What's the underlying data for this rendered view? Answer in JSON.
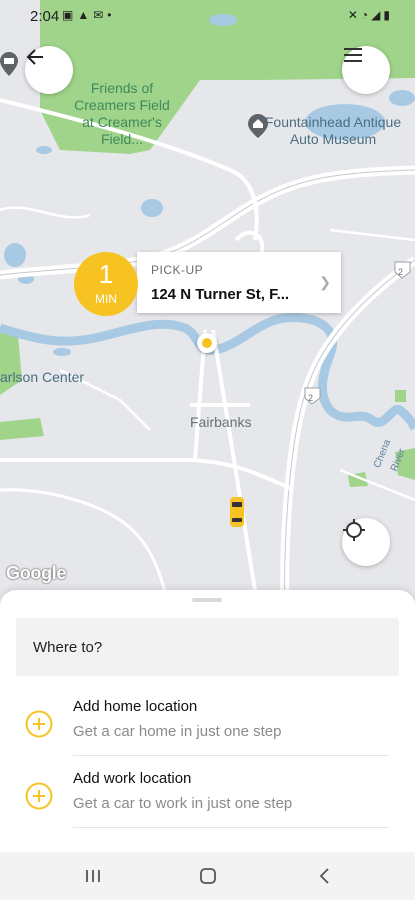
{
  "status_bar": {
    "time": "2:04",
    "left_icons": [
      "image-icon",
      "alert-icon",
      "mail-icon",
      "dot-icon"
    ],
    "right_icons": [
      "mute-icon",
      "wifi-icon",
      "signal-icon",
      "battery-icon"
    ]
  },
  "map": {
    "labels": {
      "friends_field": "Friends of\nCreamers Field\nat Creamer's\nField...",
      "museum": "Fountainhead Antique\nAuto Museum",
      "carlson": "arlson Center",
      "fairbanks": "Fairbanks",
      "river": "Chena River"
    },
    "road_shields": [
      "2",
      "2"
    ],
    "google_logo": "Google"
  },
  "pickup": {
    "eta_value": "1",
    "eta_unit": "MIN",
    "label": "PICK-UP",
    "address": "124 N Turner St, F..."
  },
  "sheet": {
    "search_placeholder": "Where to?",
    "locations": [
      {
        "title": "Add home location",
        "subtitle": "Get a car home in just one step"
      },
      {
        "title": "Add work location",
        "subtitle": "Get a car to work in just one step"
      }
    ]
  },
  "colors": {
    "accent": "#f6c323",
    "water": "#a8c9e3",
    "park": "#9fd48a",
    "map_bg": "#e6e7ea"
  }
}
